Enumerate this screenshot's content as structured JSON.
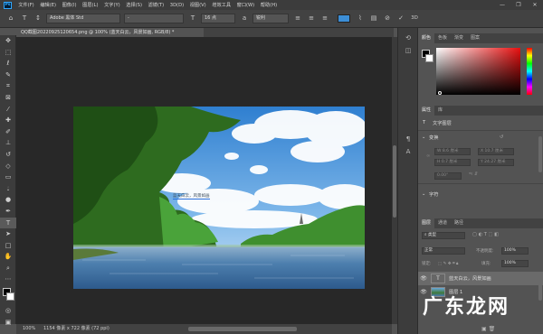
{
  "app": {
    "logo": "Ps"
  },
  "menu": [
    "文件(F)",
    "编辑(E)",
    "图像(I)",
    "图层(L)",
    "文字(Y)",
    "选择(S)",
    "滤镜(T)",
    "3D(D)",
    "视图(V)",
    "增效工具",
    "窗口(W)",
    "帮助(H)"
  ],
  "window_controls": [
    "—",
    "❐",
    "✕"
  ],
  "options": {
    "font_family": "Adobe 黑体 Std",
    "font_style": "-",
    "font_size": "16 点",
    "antialias": "锐利",
    "three_d": "3D"
  },
  "document": {
    "tab_title": "QQ截图20220925120654.png @ 100% (蓝天白云，风景如画, RGB/8) *",
    "text_layer_label": "蓝天白云，风景如画"
  },
  "status": {
    "zoom": "100%",
    "dimensions": "1154 像素 x 722 像素 (72 ppi)"
  },
  "color_panel": {
    "tabs": [
      "颜色",
      "色板",
      "渐变",
      "图案"
    ]
  },
  "properties_panel": {
    "tabs": [
      "属性",
      "库"
    ],
    "type_label": "文字图层",
    "transform_label": "变换",
    "field_w": "W 8.6 厘米",
    "field_h": "H 0.7 厘米",
    "field_x": "X 10.7 厘米",
    "field_y": "Y 24.27 厘米",
    "field_angle": "0.00°",
    "char_label": "字符"
  },
  "layers_panel": {
    "tabs": [
      "图层",
      "通道",
      "路径"
    ],
    "blend": "正常",
    "opacity_label": "不透明度:",
    "opacity": "100%",
    "lock_label": "锁定:",
    "fill_label": "填充:",
    "fill": "100%",
    "layers": [
      {
        "name": "蓝天白云，风景如画",
        "kind": "T"
      },
      {
        "name": "图层 1",
        "kind": "img"
      }
    ]
  },
  "watermark": "广东龙网"
}
